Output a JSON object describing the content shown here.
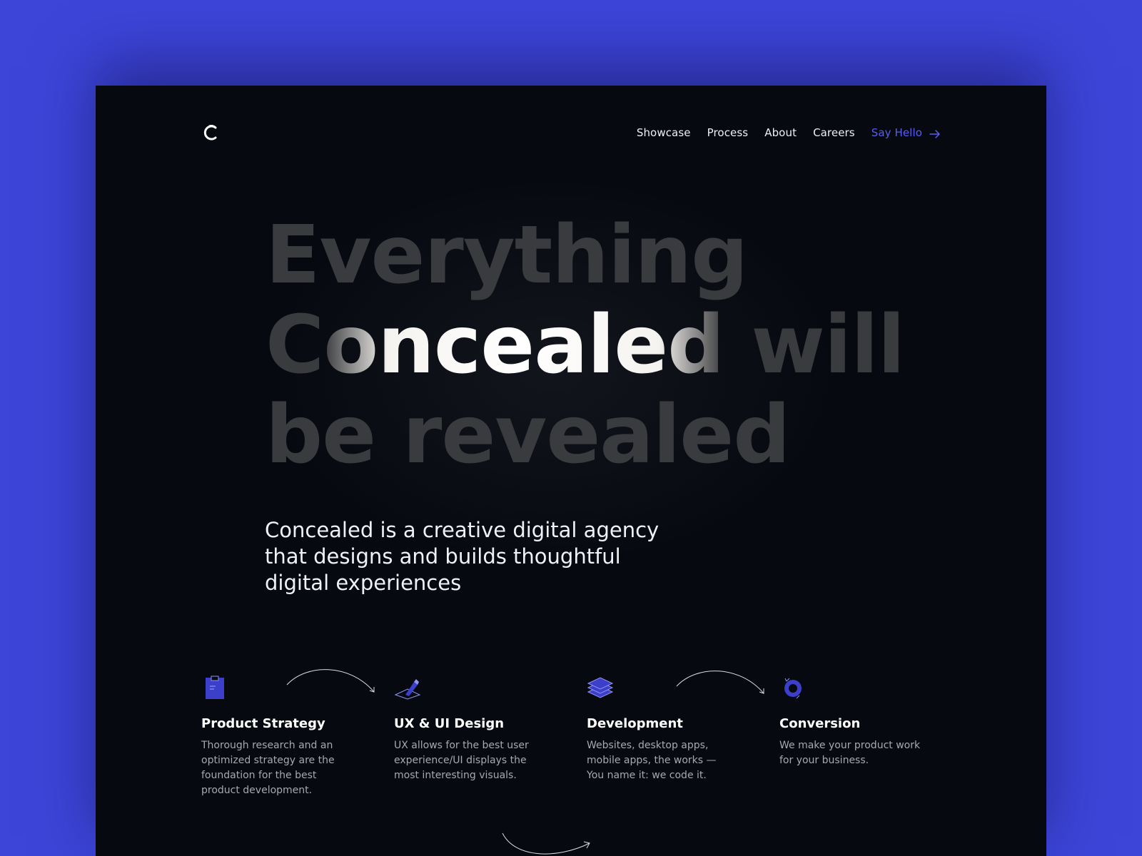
{
  "nav": {
    "logo": "c-logo",
    "links": [
      "Showcase",
      "Process",
      "About",
      "Careers"
    ],
    "cta": "Say Hello",
    "cta_icon": "arrow-right-icon",
    "cta_color": "#5a5cf0"
  },
  "hero": {
    "line1": "Everything",
    "line2_start": "C",
    "line2_shine": "oncealed",
    "line2_end": " will",
    "line3": "be revealed"
  },
  "intro": "Concealed is a creative digital agency that designs and builds thoughtful digital experiences",
  "services": [
    {
      "icon": "clipboard-icon",
      "title": "Product Strategy",
      "desc": "Thorough research and an optimized strategy are the foundation for the best product development."
    },
    {
      "icon": "pen-tool-icon",
      "title": "UX & UI Design",
      "desc": "UX allows for the best user experience/UI displays the most interesting visuals."
    },
    {
      "icon": "layers-icon",
      "title": "Development",
      "desc": "Websites, desktop apps, mobile apps, the works — You name it: we code it."
    },
    {
      "icon": "refresh-icon",
      "title": "Conversion",
      "desc": "We make your product work for your business."
    }
  ],
  "colors": {
    "page_bg": "#3d45d9",
    "frame_bg": "#060a10",
    "accent": "#5a5cf0",
    "icon_fill": "#3b3fc9"
  }
}
